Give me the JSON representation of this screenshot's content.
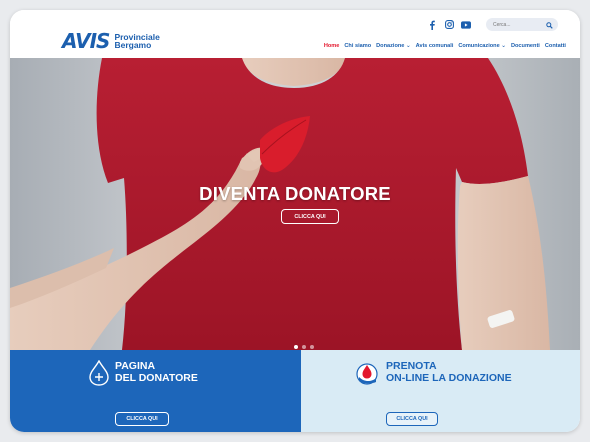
{
  "header": {
    "logo": {
      "mark": "AVIS",
      "line1": "Provinciale",
      "line2": "Bergamo"
    },
    "social": [
      "facebook-icon",
      "instagram-icon",
      "youtube-icon"
    ],
    "search": {
      "placeholder": "Cerca..."
    },
    "nav": [
      {
        "label": "Home",
        "active": true
      },
      {
        "label": "Chi siamo",
        "active": false
      },
      {
        "label": "Donazione ⌄",
        "active": false
      },
      {
        "label": "Avis comunali",
        "active": false
      },
      {
        "label": "Comunicazione ⌄",
        "active": false
      },
      {
        "label": "Documenti",
        "active": false
      },
      {
        "label": "Contatti",
        "active": false
      }
    ]
  },
  "hero": {
    "title": "DIVENTA DONATORE",
    "button": "CLICCA QUI",
    "slides": 3,
    "active_slide": 1
  },
  "panels": {
    "left": {
      "title_line1": "PAGINA",
      "title_line2": "DEL DONATORE",
      "button": "CLICCA QUI"
    },
    "right": {
      "title_line1": "PRENOTA",
      "title_line2": "ON-LINE LA DONAZIONE",
      "button": "CLICCA QUI"
    }
  },
  "colors": {
    "brand_blue": "#1d66ba",
    "accent_red": "#e3172d",
    "shirt_red": "#b01a2e",
    "light_panel": "#d9ebf5"
  }
}
